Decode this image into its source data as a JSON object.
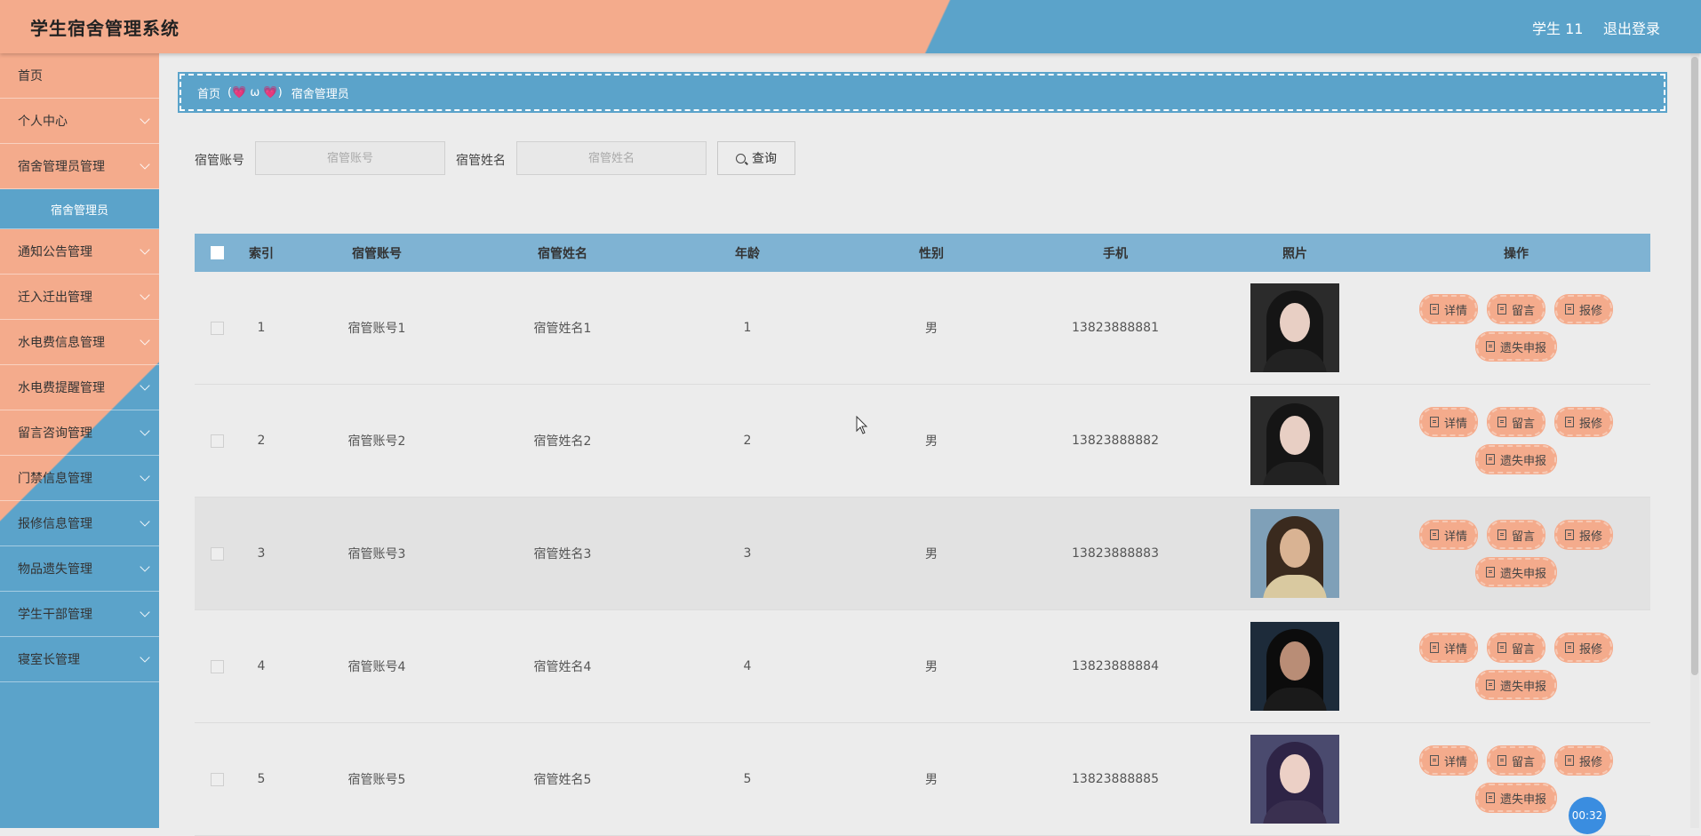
{
  "header": {
    "title": "学生宿舍管理系统",
    "user": "学生 11",
    "logout": "退出登录"
  },
  "sidebar": {
    "items": [
      {
        "label": "首页",
        "arrow": false
      },
      {
        "label": "个人中心",
        "arrow": true
      },
      {
        "label": "宿舍管理员管理",
        "arrow": true,
        "submenu": "宿舍管理员"
      },
      {
        "label": "通知公告管理",
        "arrow": true
      },
      {
        "label": "迁入迁出管理",
        "arrow": true
      },
      {
        "label": "水电费信息管理",
        "arrow": true
      },
      {
        "label": "水电费提醒管理",
        "arrow": true
      },
      {
        "label": "留言咨询管理",
        "arrow": true
      },
      {
        "label": "门禁信息管理",
        "arrow": true
      },
      {
        "label": "报修信息管理",
        "arrow": true
      },
      {
        "label": "物品遗失管理",
        "arrow": true
      },
      {
        "label": "学生干部管理",
        "arrow": true
      },
      {
        "label": "寝室长管理",
        "arrow": true
      }
    ]
  },
  "breadcrumb": {
    "home": "首页",
    "separator": "(💗 ω 💗)",
    "current": "宿舍管理员"
  },
  "search": {
    "account_label": "宿管账号",
    "account_placeholder": "宿管账号",
    "name_label": "宿管姓名",
    "name_placeholder": "宿管姓名",
    "button": "查询"
  },
  "table": {
    "columns": [
      "索引",
      "宿管账号",
      "宿管姓名",
      "年龄",
      "性别",
      "手机",
      "照片",
      "操作"
    ],
    "rows": [
      {
        "index": "1",
        "account": "宿管账号1",
        "name": "宿管姓名1",
        "age": "1",
        "sex": "男",
        "phone": "13823888881",
        "photo": "photo-girl-dark-hair"
      },
      {
        "index": "2",
        "account": "宿管账号2",
        "name": "宿管姓名2",
        "age": "2",
        "sex": "男",
        "phone": "13823888882",
        "photo": "photo-girl-dark-hair"
      },
      {
        "index": "3",
        "account": "宿管账号3",
        "name": "宿管姓名3",
        "age": "3",
        "sex": "男",
        "phone": "13823888883",
        "photo": "photo-girl-outdoor"
      },
      {
        "index": "4",
        "account": "宿管账号4",
        "name": "宿管姓名4",
        "age": "4",
        "sex": "男",
        "phone": "13823888884",
        "photo": "photo-boy-profile"
      },
      {
        "index": "5",
        "account": "宿管账号5",
        "name": "宿管姓名5",
        "age": "5",
        "sex": "男",
        "phone": "13823888885",
        "photo": "photo-girl-purple-hair"
      }
    ],
    "actions": [
      "详情",
      "留言",
      "报修",
      "遗失申报"
    ]
  },
  "timer": "00:32",
  "colors": {
    "accent_pink": "#f4ab8c",
    "accent_blue": "#5ba3ca",
    "table_header": "#7fb3d3"
  }
}
